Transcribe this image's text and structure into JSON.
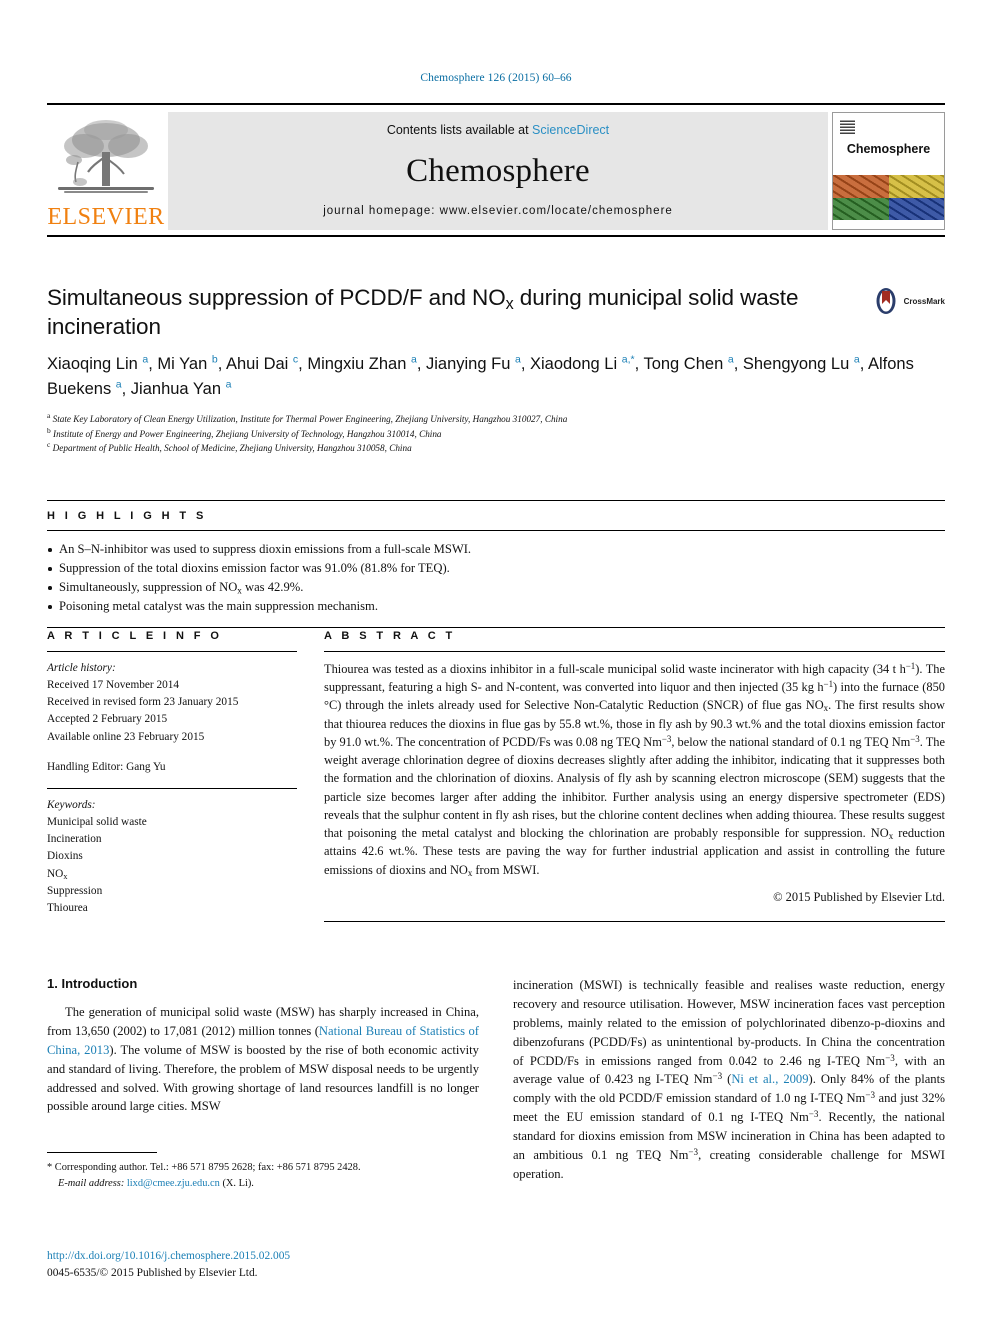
{
  "running_head": "Chemosphere 126 (2015) 60–66",
  "masthead": {
    "contents_prefix": "Contents lists available at ",
    "sciencedirect": "ScienceDirect",
    "journal_name": "Chemosphere",
    "homepage": "journal homepage: www.elsevier.com/locate/chemosphere",
    "publisher_logo_text": "ELSEVIER",
    "cover_title": "Chemosphere",
    "cover_colors": [
      "#c0561e",
      "#d0b62a",
      "#2f7a2a",
      "#1e3f99"
    ]
  },
  "article": {
    "title": "Simultaneous suppression of PCDD/F and NO<sub class=\"sub\">x</sub> during municipal solid waste incineration",
    "crossmark_label": "CrossMark",
    "authors_html": "Xiaoqing Lin <sup class=\"aff\">a</sup>, Mi Yan <sup class=\"aff\">b</sup>, Ahui Dai <sup class=\"aff\">c</sup>, Mingxiu Zhan <sup class=\"aff\">a</sup>, Jianying Fu <sup class=\"aff\">a</sup>, Xiaodong Li <sup class=\"aff\">a,*</sup>, Tong Chen <sup class=\"aff\">a</sup>, Shengyong Lu <sup class=\"aff\">a</sup>, Alfons Buekens <sup class=\"aff\">a</sup>, Jianhua Yan <sup class=\"aff\">a</sup>",
    "affiliations": [
      "<sup>a</sup> State Key Laboratory of Clean Energy Utilization, Institute for Thermal Power Engineering, Zhejiang University, Hangzhou 310027, China",
      "<sup>b</sup> Institute of Energy and Power Engineering, Zhejiang University of Technology, Hangzhou 310014, China",
      "<sup>c</sup> Department of Public Health, School of Medicine, Zhejiang University, Hangzhou 310058, China"
    ]
  },
  "highlights": {
    "heading": "H I G H L I G H T S",
    "items": [
      "An S–N-inhibitor was used to suppress dioxin emissions from a full-scale MSWI.",
      "Suppression of the total dioxins emission factor was 91.0% (81.8% for TEQ).",
      "Simultaneously, suppression of NO<sub class=\"sub\">x</sub> was 42.9%.",
      "Poisoning metal catalyst was the main suppression mechanism."
    ]
  },
  "article_info": {
    "heading": "A R T I C L E    I N F O",
    "history_label": "Article history:",
    "history": [
      "Received 17 November 2014",
      "Received in revised form 23 January 2015",
      "Accepted 2 February 2015",
      "Available online 23 February 2015"
    ],
    "handling_editor": "Handling Editor: Gang Yu",
    "keywords_label": "Keywords:",
    "keywords_html": [
      "Municipal solid waste",
      "Incineration",
      "Dioxins",
      "NO<sub class=\"sub\">x</sub>",
      "Suppression",
      "Thiourea"
    ]
  },
  "abstract": {
    "heading": "A B S T R A C T",
    "text_html": "Thiourea was tested as a dioxins inhibitor in a full-scale municipal solid waste incinerator with high capacity (34 t h<sup class=\"sup\">−1</sup>). The suppressant, featuring a high S- and N-content, was converted into liquor and then injected (35 kg h<sup class=\"sup\">−1</sup>) into the furnace (850 °C) through the inlets already used for Selective Non-Catalytic Reduction (SNCR) of flue gas NO<sub class=\"sub\">x</sub>. The first results show that thiourea reduces the dioxins in flue gas by 55.8 wt.%, those in fly ash by 90.3 wt.% and the total dioxins emission factor by 91.0 wt.%. The concentration of PCDD/Fs was 0.08 ng TEQ Nm<sup class=\"sup\">−3</sup>, below the national standard of 0.1 ng TEQ Nm<sup class=\"sup\">−3</sup>. The weight average chlorination degree of dioxins decreases slightly after adding the inhibitor, indicating that it suppresses both the formation and the chlorination of dioxins. Analysis of fly ash by scanning electron microscope (SEM) suggests that the particle size becomes larger after adding the inhibitor. Further analysis using an energy dispersive spectrometer (EDS) reveals that the sulphur content in fly ash rises, but the chlorine content declines when adding thiourea. These results suggest that poisoning the metal catalyst and blocking the chlorination are probably responsible for suppression. NO<sub class=\"sub\">x</sub> reduction attains 42.6 wt.%. These tests are paving the way for further industrial application and assist in controlling the future emissions of dioxins and NO<sub class=\"sub\">x</sub> from MSWI.",
    "copyright": "© 2015 Published by Elsevier Ltd."
  },
  "introduction": {
    "heading": "1. Introduction",
    "left_paragraph_html": "The generation of municipal solid waste (MSW) has sharply increased in China, from 13,650 (2002) to 17,081 (2012) million tonnes (<span class=\"ref\">National Bureau of Statistics of China, 2013</span>). The volume of MSW is boosted by the rise of both economic activity and standard of living. Therefore, the problem of MSW disposal needs to be urgently addressed and solved. With growing shortage of land resources landfill is no longer possible around large cities. MSW",
    "right_paragraph_html": "incineration (MSWI) is technically feasible and realises waste reduction, energy recovery and resource utilisation. However, MSW incineration faces vast perception problems, mainly related to the emission of polychlorinated dibenzo-p-dioxins and dibenzofurans (PCDD/Fs) as unintentional by-products. In China the concentration of PCDD/Fs in emissions ranged from 0.042 to 2.46 ng I-TEQ Nm<sup class=\"sup\">−3</sup>, with an average value of 0.423 ng I-TEQ Nm<sup class=\"sup\">−3</sup> (<span class=\"ref\">Ni et al., 2009</span>). Only 84% of the plants comply with the old PCDD/F emission standard of 1.0 ng I-TEQ Nm<sup class=\"sup\">−3</sup> and just 32% meet the EU emission standard of 0.1 ng I-TEQ Nm<sup class=\"sup\">−3</sup>. Recently, the national standard for dioxins emission from MSW incineration in China has been adapted to an ambitious 0.1 ng TEQ Nm<sup class=\"sup\">−3</sup>, creating considerable challenge for MSWI operation."
  },
  "footnotes": {
    "corresponding_html": "* Corresponding author. Tel.: +86 571 8795 2628; fax: +86 571 8795 2428.",
    "email_html": "<span class=\"ital\">E-mail address:</span> <span class=\"ref\">lixd@cmee.zju.edu.cn</span> (X. Li).",
    "doi": "http://dx.doi.org/10.1016/j.chemosphere.2015.02.005",
    "issn_html": "0045-6535/© 2015 Published by Elsevier Ltd."
  }
}
